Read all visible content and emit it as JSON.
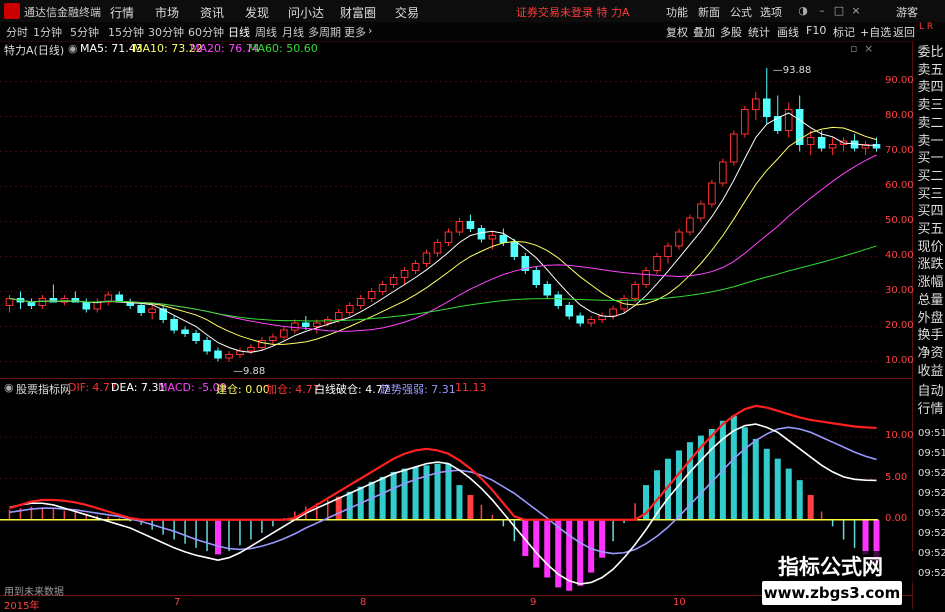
{
  "titlebar": {
    "app_title": "通达信金融终端",
    "menu": [
      "行情",
      "市场",
      "资讯",
      "发现",
      "问小达",
      "财富圈",
      "交易"
    ],
    "status": "证券交易未登录 特 力A",
    "right_menu": [
      "功能",
      "新面",
      "公式",
      "选项"
    ],
    "guest": "游客"
  },
  "periods": [
    "分时",
    "1分钟",
    "5分钟",
    "15分钟",
    "30分钟",
    "60分钟",
    "日线",
    "周线",
    "月线",
    "多周期",
    "更多"
  ],
  "active_period": "日线",
  "toolbar": [
    "复权",
    "叠加",
    "多股",
    "统计",
    "画线",
    "F10",
    "标记",
    "+自选",
    "返回"
  ],
  "main_info": {
    "stock": "特力A(日线)",
    "ma5": "MA5: 71.43",
    "ma10": "MA10: 73.22",
    "ma20": "MA20: 76.74",
    "ma60": "MA60: 50.60",
    "colors": {
      "ma5": "#ffffff",
      "ma10": "#ffff66",
      "ma20": "#ff44ff",
      "ma60": "#33dd33"
    }
  },
  "indicator_info": {
    "name": "股票指标网",
    "dif": "DIF: 4.77",
    "dea": "DEA: 7.31",
    "macd": "MACD: -5.09",
    "jc": "建仓: 0.00",
    "jc2": "加仓: 4.77",
    "bx": "白线破仓: 4.77",
    "qs": "趋势强弱: 7.31",
    "last": "11.13"
  },
  "side_panel": {
    "top_letters": [
      "L",
      "R"
    ],
    "items": [
      "委比",
      "卖五",
      "卖四",
      "卖三",
      "卖二",
      "卖一",
      "买一",
      "买二",
      "买三",
      "买四",
      "买五",
      "现价",
      "涨跌",
      "涨幅",
      "总量",
      "外盘",
      "换手",
      "净资",
      "收益"
    ],
    "lower_items": [
      "自动",
      "行情"
    ],
    "times": [
      "09:51",
      "09:51",
      "09:52",
      "09:52",
      "09:52",
      "09:52",
      "09:52",
      "09:52"
    ]
  },
  "price_axis": [
    "90.00",
    "80.00",
    "70.00",
    "60.00",
    "50.00",
    "40.00",
    "30.00",
    "20.00",
    "10.00"
  ],
  "indicator_axis": [
    "10.00",
    "5.00",
    "0.00"
  ],
  "price_annotations": {
    "high": "93.88",
    "low": "9.88"
  },
  "x_axis": [
    "2015年",
    "7",
    "8",
    "9",
    "10"
  ],
  "footer_text": "用到未来数据",
  "watermark": {
    "line1": "指标公式网",
    "line2": "www.zbgs3.com"
  },
  "chart_data": {
    "type": "candlestick",
    "price_range": [
      5,
      97
    ],
    "candles": [
      [
        26,
        29,
        24,
        28
      ],
      [
        28,
        30,
        25,
        27
      ],
      [
        27,
        28,
        25,
        26
      ],
      [
        26,
        29,
        25,
        28
      ],
      [
        28,
        32,
        27,
        27
      ],
      [
        27,
        29,
        26,
        28
      ],
      [
        28,
        30,
        27,
        27
      ],
      [
        27,
        28,
        24,
        25
      ],
      [
        25,
        28,
        24,
        27
      ],
      [
        27,
        30,
        26,
        29
      ],
      [
        29,
        30,
        27,
        27
      ],
      [
        27,
        28,
        25,
        26
      ],
      [
        26,
        27,
        23,
        24
      ],
      [
        24,
        26,
        22,
        25
      ],
      [
        25,
        26,
        21,
        22
      ],
      [
        22,
        23,
        18,
        19
      ],
      [
        19,
        20,
        17,
        18
      ],
      [
        18,
        19,
        15,
        16
      ],
      [
        16,
        17,
        12,
        13
      ],
      [
        13,
        14,
        10,
        11
      ],
      [
        11,
        13,
        9.88,
        12
      ],
      [
        12,
        14,
        11,
        13
      ],
      [
        13,
        15,
        12,
        14
      ],
      [
        14,
        17,
        13,
        16
      ],
      [
        16,
        18,
        15,
        17
      ],
      [
        17,
        20,
        16,
        19
      ],
      [
        19,
        22,
        18,
        21
      ],
      [
        21,
        23,
        19,
        20
      ],
      [
        20,
        22,
        18,
        21
      ],
      [
        21,
        23,
        20,
        22
      ],
      [
        22,
        25,
        21,
        24
      ],
      [
        24,
        27,
        23,
        26
      ],
      [
        26,
        29,
        25,
        28
      ],
      [
        28,
        31,
        27,
        30
      ],
      [
        30,
        33,
        29,
        32
      ],
      [
        32,
        35,
        31,
        34
      ],
      [
        34,
        37,
        32,
        36
      ],
      [
        36,
        39,
        35,
        38
      ],
      [
        38,
        42,
        37,
        41
      ],
      [
        41,
        45,
        40,
        44
      ],
      [
        44,
        48,
        43,
        47
      ],
      [
        47,
        51,
        46,
        50
      ],
      [
        50,
        52,
        47,
        48
      ],
      [
        48,
        49,
        44,
        45
      ],
      [
        45,
        47,
        42,
        46
      ],
      [
        46,
        48,
        43,
        44
      ],
      [
        44,
        45,
        39,
        40
      ],
      [
        40,
        41,
        35,
        36
      ],
      [
        36,
        37,
        31,
        32
      ],
      [
        32,
        33,
        28,
        29
      ],
      [
        29,
        30,
        25,
        26
      ],
      [
        26,
        27,
        22,
        23
      ],
      [
        23,
        24,
        20,
        21
      ],
      [
        21,
        23,
        20,
        22
      ],
      [
        22,
        24,
        21,
        23
      ],
      [
        23,
        26,
        22,
        25
      ],
      [
        25,
        29,
        24,
        28
      ],
      [
        28,
        33,
        27,
        32
      ],
      [
        32,
        37,
        31,
        36
      ],
      [
        36,
        41,
        35,
        40
      ],
      [
        40,
        44,
        38,
        43
      ],
      [
        43,
        48,
        42,
        47
      ],
      [
        47,
        52,
        46,
        51
      ],
      [
        51,
        56,
        50,
        55
      ],
      [
        55,
        62,
        54,
        61
      ],
      [
        61,
        68,
        60,
        67
      ],
      [
        67,
        76,
        66,
        75
      ],
      [
        75,
        83,
        74,
        82
      ],
      [
        82,
        87,
        79,
        85
      ],
      [
        85,
        93.88,
        78,
        80
      ],
      [
        80,
        86,
        75,
        76
      ],
      [
        76,
        84,
        74,
        82
      ],
      [
        82,
        86,
        70,
        72
      ],
      [
        72,
        76,
        69,
        74
      ],
      [
        74,
        76,
        70,
        71
      ],
      [
        71,
        74,
        69,
        72
      ],
      [
        72,
        74,
        70,
        73
      ],
      [
        73,
        75,
        70,
        71
      ],
      [
        71,
        73,
        69,
        72
      ],
      [
        72,
        74,
        70,
        71
      ]
    ],
    "series": [
      {
        "name": "MA5",
        "color": "#ffffff"
      },
      {
        "name": "MA10",
        "color": "#ffff66"
      },
      {
        "name": "MA20",
        "color": "#ff44ff"
      },
      {
        "name": "MA60",
        "color": "#33dd33"
      }
    ],
    "indicator": {
      "range": [
        -9,
        15
      ],
      "macd": [
        1.2,
        1.4,
        1.6,
        1.5,
        1.3,
        1.1,
        0.9,
        0.7,
        0.5,
        0.4,
        0.2,
        -0.2,
        -0.6,
        -1.2,
        -1.8,
        -2.4,
        -2.9,
        -3.4,
        -3.8,
        -4.2,
        -3.8,
        -3.1,
        -2.4,
        -1.6,
        -0.8,
        0.2,
        1.0,
        1.6,
        2.0,
        2.4,
        2.8,
        3.4,
        4.0,
        4.6,
        5.2,
        5.8,
        6.2,
        6.4,
        6.6,
        6.8,
        6.8,
        4.2,
        3.0,
        1.8,
        0.6,
        -0.8,
        -2.6,
        -4.4,
        -5.8,
        -7.0,
        -8.2,
        -8.6,
        -8.0,
        -6.4,
        -4.6,
        -2.6,
        -0.4,
        2.0,
        4.2,
        6.0,
        7.4,
        8.4,
        9.4,
        10.2,
        11.0,
        12.0,
        12.6,
        11.2,
        9.8,
        8.6,
        7.4,
        6.2,
        4.8,
        3.0,
        1.0,
        -0.8,
        -2.4,
        -3.4,
        -4.2,
        -5.09
      ],
      "dif": [
        1.5,
        1.8,
        2.0,
        2.0,
        1.8,
        1.4,
        1.0,
        0.6,
        0.2,
        -0.2,
        -0.6,
        -1.0,
        -1.6,
        -2.2,
        -2.8,
        -3.4,
        -3.9,
        -4.3,
        -4.6,
        -4.9,
        -4.6,
        -4.0,
        -3.2,
        -2.4,
        -1.6,
        -0.8,
        0.0,
        0.8,
        1.4,
        2.0,
        2.6,
        3.2,
        3.8,
        4.4,
        5.0,
        5.6,
        6.0,
        6.4,
        6.8,
        7.0,
        6.8,
        6.0,
        5.0,
        3.8,
        2.4,
        0.8,
        -0.8,
        -2.4,
        -4.0,
        -5.4,
        -6.6,
        -7.4,
        -7.8,
        -7.6,
        -7.0,
        -6.0,
        -4.6,
        -3.0,
        -1.2,
        0.8,
        2.6,
        4.2,
        5.8,
        7.2,
        8.6,
        9.8,
        10.8,
        11.4,
        11.6,
        11.2,
        10.6,
        9.6,
        8.6,
        7.6,
        6.6,
        5.8,
        5.2,
        4.9,
        4.8,
        4.77
      ],
      "dea": [
        0.9,
        1.1,
        1.3,
        1.4,
        1.4,
        1.3,
        1.2,
        1.0,
        0.8,
        0.6,
        0.4,
        0.1,
        -0.2,
        -0.6,
        -1.0,
        -1.4,
        -1.9,
        -2.4,
        -2.8,
        -3.2,
        -3.5,
        -3.6,
        -3.5,
        -3.2,
        -2.8,
        -2.3,
        -1.7,
        -1.0,
        -0.4,
        0.2,
        0.8,
        1.4,
        2.0,
        2.6,
        3.2,
        3.8,
        4.4,
        4.9,
        5.3,
        5.7,
        5.9,
        6.0,
        5.8,
        5.4,
        4.8,
        4.0,
        3.2,
        2.2,
        1.2,
        0.2,
        -0.9,
        -1.9,
        -2.8,
        -3.5,
        -3.9,
        -4.1,
        -4.0,
        -3.6,
        -2.9,
        -2.0,
        -0.9,
        0.4,
        1.8,
        3.2,
        4.6,
        6.0,
        7.4,
        8.6,
        9.6,
        10.4,
        11.0,
        11.2,
        11.0,
        10.6,
        10.0,
        9.4,
        8.8,
        8.2,
        7.7,
        7.31
      ],
      "red_line": [
        1.4,
        1.8,
        2.2,
        2.4,
        2.4,
        2.3,
        2.1,
        1.8,
        1.4,
        1.0,
        0.6,
        0.2,
        0,
        0,
        0,
        0,
        0,
        0,
        0,
        0,
        0,
        0,
        0,
        0,
        0,
        0,
        0.2,
        1.0,
        1.8,
        2.6,
        3.4,
        4.2,
        5.0,
        5.8,
        6.6,
        7.4,
        8.0,
        8.4,
        8.6,
        8.4,
        8.0,
        7.2,
        6.2,
        5.0,
        3.6,
        2.0,
        0.4,
        0,
        0,
        0,
        0,
        0,
        0,
        0,
        0,
        0,
        0,
        0,
        0.8,
        2.4,
        4.0,
        5.6,
        7.2,
        8.8,
        10.2,
        11.6,
        12.6,
        13.4,
        13.8,
        13.6,
        13.2,
        12.8,
        12.4,
        12.1,
        11.9,
        11.7,
        11.5,
        11.3,
        11.2,
        11.13
      ]
    }
  }
}
